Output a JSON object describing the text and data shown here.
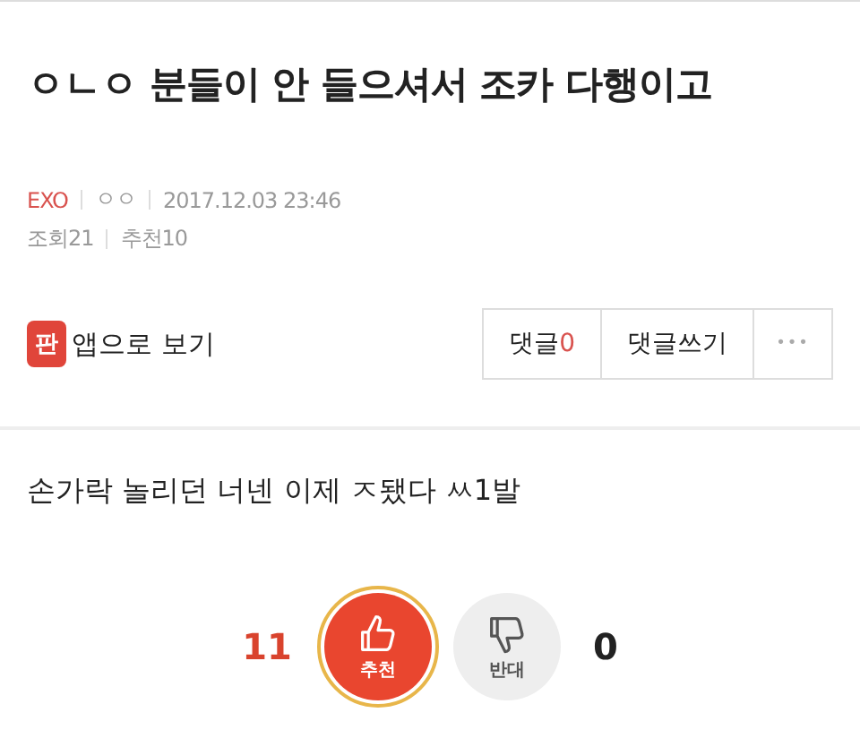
{
  "title": "ㅇㄴㅇ 분들이 안 들으셔서 조카 다행이고",
  "meta": {
    "board": "EXO",
    "author": "ㅇㅇ",
    "date": "2017.12.03 23:46",
    "views": "조회21",
    "recommends": "추천10"
  },
  "app_link": {
    "badge": "판",
    "label": "앱으로 보기"
  },
  "actions": {
    "comments_label": "댓글",
    "comments_count": "0",
    "write": "댓글쓰기",
    "more": "•••"
  },
  "body": "손가락 놀리던 너넨 이제 ㅈ됐다 ㅆ1발",
  "votes": {
    "up_count": "11",
    "up_label": "추천",
    "up_selected": true,
    "down_label": "반대",
    "down_selected": false,
    "down_count": "0"
  }
}
